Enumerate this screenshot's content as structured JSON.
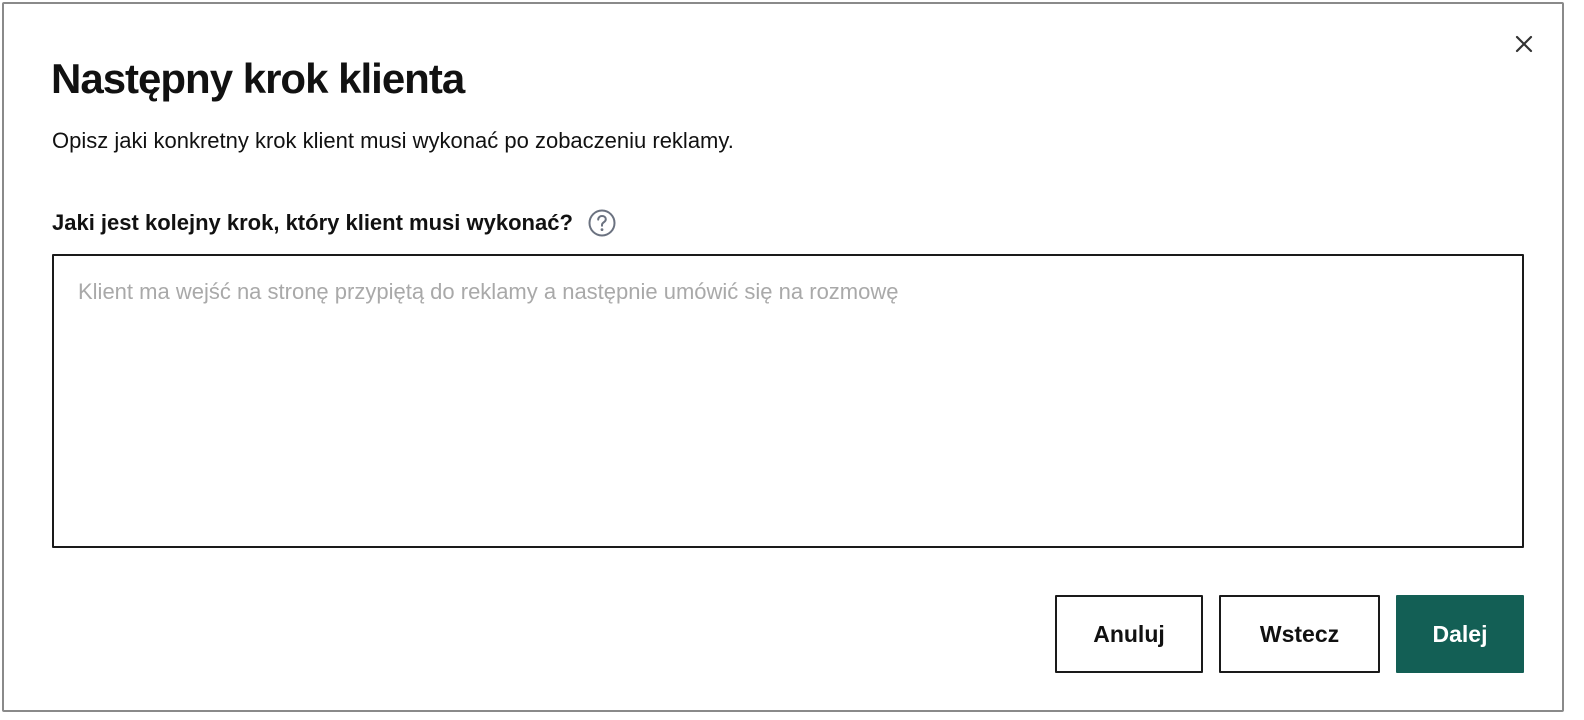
{
  "dialog": {
    "title": "Następny krok klienta",
    "subtitle": "Opisz jaki konkretny krok klient musi wykonać po zobaczeniu reklamy.",
    "close_icon": "close-icon",
    "field": {
      "label": "Jaki jest kolejny krok, który klient musi wykonać?",
      "help_icon": "question-circle-icon",
      "value": "",
      "placeholder": "Klient ma wejść na stronę przypiętą do reklamy a następnie umówić się na rozmowę"
    },
    "buttons": {
      "cancel_label": "Anuluj",
      "back_label": "Wstecz",
      "next_label": "Dalej"
    }
  },
  "colors": {
    "primary": "#135f55",
    "border": "#1a1a1a",
    "placeholder": "#a9a9a9",
    "dialog_border": "#8a8a8a",
    "icon": "#6b7280"
  }
}
